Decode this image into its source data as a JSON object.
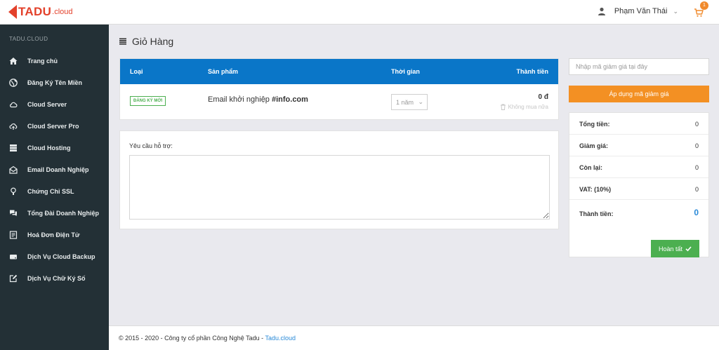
{
  "header": {
    "logo_text": "TADU",
    "logo_suffix": ".cloud",
    "user_name": "Phạm Văn Thái",
    "cart_count": "1"
  },
  "sidebar": {
    "brand": "TADU.CLOUD",
    "items": [
      {
        "label": "Trang chủ",
        "icon": "home-icon"
      },
      {
        "label": "Đăng Ký Tên Miền",
        "icon": "globe-icon"
      },
      {
        "label": "Cloud Server",
        "icon": "cloud-icon"
      },
      {
        "label": "Cloud Server Pro",
        "icon": "cloud-upload-icon"
      },
      {
        "label": "Cloud Hosting",
        "icon": "database-icon"
      },
      {
        "label": "Email Doanh Nghiệp",
        "icon": "envelope-open-icon"
      },
      {
        "label": "Chứng Chỉ SSL",
        "icon": "lightbulb-icon"
      },
      {
        "label": "Tổng Đài Doanh Nghiệp",
        "icon": "chat-icon"
      },
      {
        "label": "Hoá Đơn Điện Tử",
        "icon": "receipt-icon"
      },
      {
        "label": "Dịch Vụ Cloud Backup",
        "icon": "drive-icon"
      },
      {
        "label": "Dịch Vụ Chữ Ký Số",
        "icon": "edit-icon"
      }
    ]
  },
  "page": {
    "title": "Giỏ Hàng"
  },
  "cart_table": {
    "headers": {
      "type": "Loại",
      "product": "Sản phẩm",
      "duration": "Thời gian",
      "total": "Thành tiền"
    },
    "row": {
      "type_badge": "ĐĂNG KÝ MỚI",
      "product_prefix": "Email khởi nghiệp ",
      "product_bold": "#info.com",
      "duration": "1 năm",
      "price": "0 đ",
      "remove_label": "Không mua nữa"
    }
  },
  "support": {
    "label": "Yêu cầu hỗ trợ:"
  },
  "coupon": {
    "placeholder": "Nhập mã giảm giá tại đây",
    "apply_label": "Áp dụng mã giảm giá"
  },
  "summary": {
    "rows": [
      {
        "label": "Tổng tiền:",
        "value": "0"
      },
      {
        "label": "Giảm giá:",
        "value": "0"
      },
      {
        "label": "Còn lại:",
        "value": "0"
      },
      {
        "label": "VAT: (10%)",
        "value": "0"
      },
      {
        "label": "Thành tiền:",
        "value": "0"
      }
    ],
    "finish_label": "Hoàn tất"
  },
  "footer": {
    "text": "© 2015 - 2020 - Công ty cổ phần Công Nghệ Tadu - ",
    "link": "Tadu.cloud"
  },
  "colors": {
    "brand": "#e3412b",
    "sidebar_bg": "#233036",
    "table_header": "#0a76c8",
    "coupon_button": "#f39023",
    "finish_button": "#4caf50",
    "link": "#2a8ad8"
  }
}
